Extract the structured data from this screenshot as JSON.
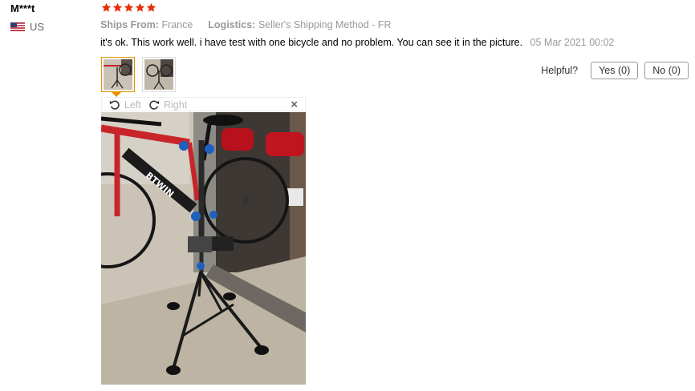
{
  "reviewer": {
    "name": "M***t",
    "country": "US",
    "flag_icon": "us-flag-icon"
  },
  "rating": {
    "stars": 5,
    "max": 5,
    "color": "#e62e04"
  },
  "meta": {
    "ships_from_label": "Ships From:",
    "ships_from_value": "France",
    "logistics_label": "Logistics:",
    "logistics_value": "Seller's Shipping Method - FR"
  },
  "review": {
    "text": "it's ok. This work well. i have test with one bicycle and no problem. You can see it in the picture.",
    "date": "05 Mar 2021 00:02"
  },
  "helpful": {
    "label": "Helpful?",
    "yes_label": "Yes (0)",
    "no_label": "No (0)"
  },
  "viewer": {
    "rotate_left_label": "Left",
    "rotate_right_label": "Right",
    "close_label": "×"
  },
  "thumbnails": {
    "count": 2,
    "selected": 1
  },
  "colors": {
    "accent": "#e88f00",
    "muted": "#999999"
  }
}
